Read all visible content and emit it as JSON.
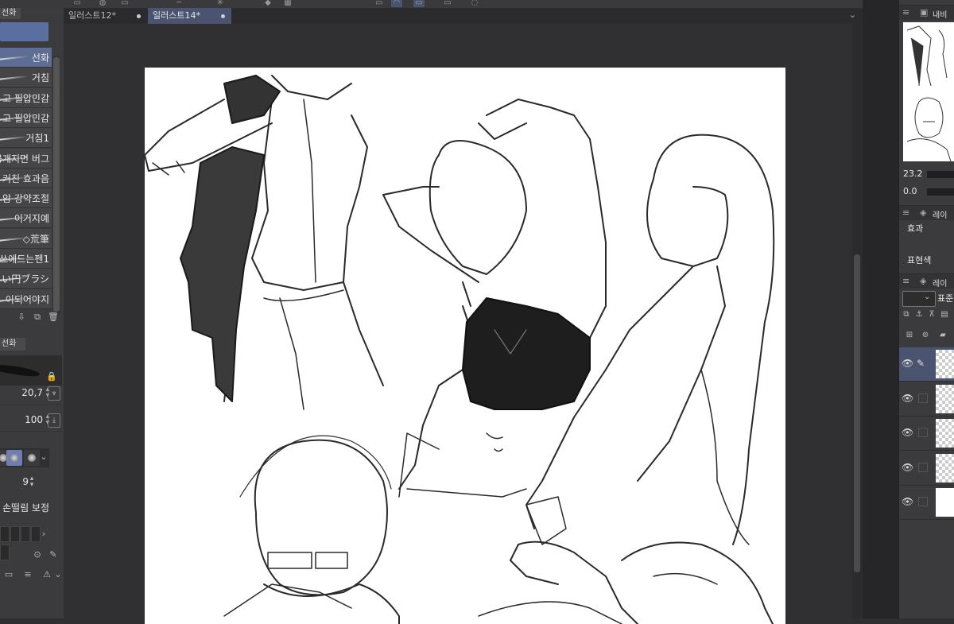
{
  "left_panel": {
    "tab": "선화",
    "brushes": [
      {
        "label": "선화",
        "active": true
      },
      {
        "label": "거침",
        "active": false
      },
      {
        "label": "고 필압민감",
        "active": false
      },
      {
        "label": "고 필압민감",
        "active": false
      },
      {
        "label": "거침1",
        "active": false
      },
      {
        "label": "뭉개지면 버그",
        "active": false
      },
      {
        "label": "커친 효과음",
        "active": false
      },
      {
        "label": "암 강약조절",
        "active": false
      },
      {
        "label": "이거지예",
        "active": false
      },
      {
        "label": "◇荒筆",
        "active": false
      },
      {
        "label": "쓰에드는펜1",
        "active": false
      },
      {
        "label": "い円ブラシ",
        "active": false
      },
      {
        "label": "이되어야지",
        "active": false
      }
    ],
    "tool_property_tab": "선화",
    "brush_size": "20,7",
    "opacity": "100",
    "stabilization_value": "9",
    "stabilization_label": "손떨림 보정"
  },
  "doc_tabs": [
    {
      "label": "일러스트12*",
      "active": false
    },
    {
      "label": "일러스트14*",
      "active": true
    }
  ],
  "right_panel": {
    "navigator_title": "내비",
    "zoom": "23.2",
    "angle": "0.0",
    "effect_panel_title": "레이",
    "effect_label": "효과",
    "expression_color_label": "표현색",
    "layer_panel_title": "레이",
    "blend_mode": "표준",
    "layers": [
      {
        "selected": true,
        "type": "transparent"
      },
      {
        "selected": false,
        "type": "transparent"
      },
      {
        "selected": false,
        "type": "transparent"
      },
      {
        "selected": false,
        "type": "transparent"
      },
      {
        "selected": false,
        "type": "white"
      }
    ]
  }
}
